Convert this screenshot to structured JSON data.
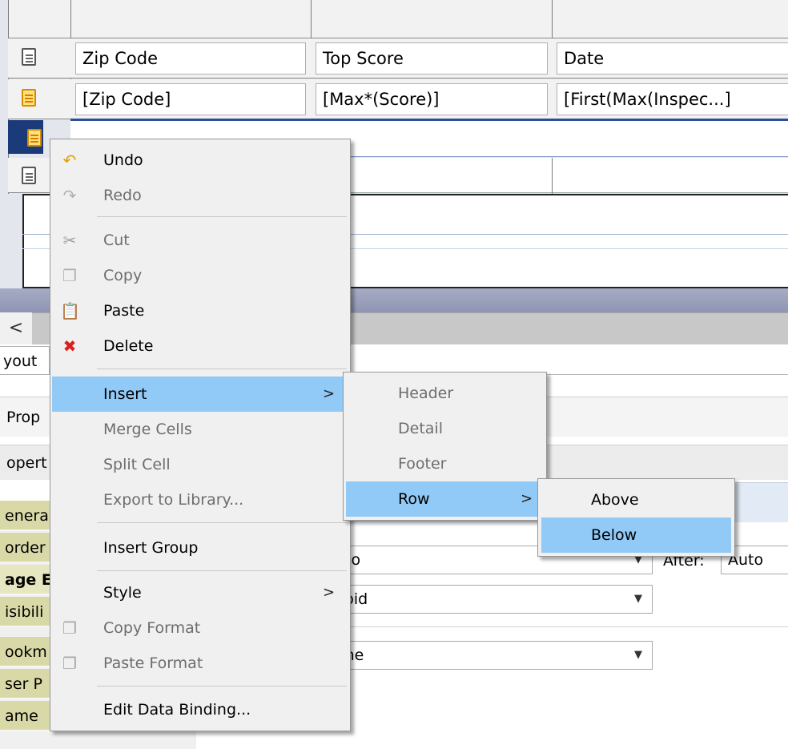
{
  "table": {
    "header_row": [
      "Zip Code",
      "Top Score",
      "Date"
    ],
    "data_row": [
      "[Zip Code]",
      "[Max*(Score)]",
      "[First(Max(Inspec...]"
    ]
  },
  "scroll": {
    "left_arrow": "<"
  },
  "tabs": {
    "layout": "yout"
  },
  "properties": {
    "tab1": "Prop",
    "tab2": "opert"
  },
  "categories": [
    "enera",
    "order",
    "age E",
    "isibili",
    "ookm",
    "ser P",
    "ame"
  ],
  "fields": {
    "page_break_before": "uto",
    "after_label": "After:",
    "page_break_after": "Auto",
    "inside": "void",
    "visibility": "one"
  },
  "context_menu": {
    "items": [
      {
        "label": "Undo",
        "icon": "undo-icon"
      },
      {
        "label": "Redo",
        "icon": "redo-icon"
      },
      {
        "label": "Cut",
        "icon": "scissors-icon"
      },
      {
        "label": "Copy",
        "icon": "copy-icon"
      },
      {
        "label": "Paste",
        "icon": "paste-icon"
      },
      {
        "label": "Delete",
        "icon": "delete-icon"
      },
      {
        "label": "Insert"
      },
      {
        "label": "Merge Cells"
      },
      {
        "label": "Split Cell"
      },
      {
        "label": "Export to Library..."
      },
      {
        "label": "Insert Group"
      },
      {
        "label": "Style"
      },
      {
        "label": "Copy Format",
        "icon": "copy-format-icon"
      },
      {
        "label": "Paste Format",
        "icon": "paste-format-icon"
      },
      {
        "label": "Edit Data Binding..."
      }
    ],
    "submenu_arrow": ">"
  },
  "insert_submenu": {
    "items": [
      "Header",
      "Detail",
      "Footer",
      "Row"
    ]
  },
  "row_submenu": {
    "items": [
      "Above",
      "Below"
    ]
  },
  "colors": {
    "highlight": "#91c9f7",
    "selected_row_border": "#2a4f9a",
    "category_bg": "#d9d9a8"
  }
}
